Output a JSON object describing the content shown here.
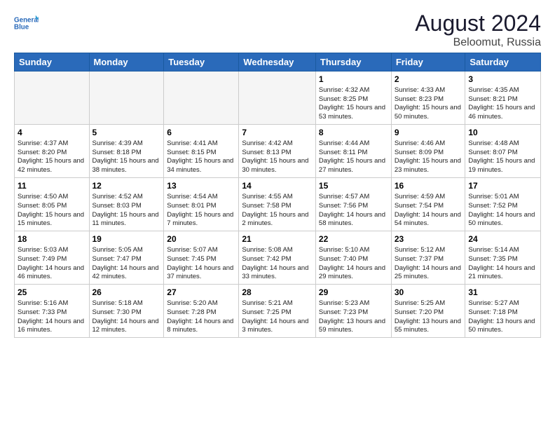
{
  "header": {
    "logo_line1": "General",
    "logo_line2": "Blue",
    "month_year": "August 2024",
    "location": "Beloomut, Russia"
  },
  "weekdays": [
    "Sunday",
    "Monday",
    "Tuesday",
    "Wednesday",
    "Thursday",
    "Friday",
    "Saturday"
  ],
  "weeks": [
    [
      {
        "day": "",
        "info": "",
        "empty": true
      },
      {
        "day": "",
        "info": "",
        "empty": true
      },
      {
        "day": "",
        "info": "",
        "empty": true
      },
      {
        "day": "",
        "info": "",
        "empty": true
      },
      {
        "day": "1",
        "info": "Sunrise: 4:32 AM\nSunset: 8:25 PM\nDaylight: 15 hours\nand 53 minutes.",
        "empty": false
      },
      {
        "day": "2",
        "info": "Sunrise: 4:33 AM\nSunset: 8:23 PM\nDaylight: 15 hours\nand 50 minutes.",
        "empty": false
      },
      {
        "day": "3",
        "info": "Sunrise: 4:35 AM\nSunset: 8:21 PM\nDaylight: 15 hours\nand 46 minutes.",
        "empty": false
      }
    ],
    [
      {
        "day": "4",
        "info": "Sunrise: 4:37 AM\nSunset: 8:20 PM\nDaylight: 15 hours\nand 42 minutes.",
        "empty": false
      },
      {
        "day": "5",
        "info": "Sunrise: 4:39 AM\nSunset: 8:18 PM\nDaylight: 15 hours\nand 38 minutes.",
        "empty": false
      },
      {
        "day": "6",
        "info": "Sunrise: 4:41 AM\nSunset: 8:15 PM\nDaylight: 15 hours\nand 34 minutes.",
        "empty": false
      },
      {
        "day": "7",
        "info": "Sunrise: 4:42 AM\nSunset: 8:13 PM\nDaylight: 15 hours\nand 30 minutes.",
        "empty": false
      },
      {
        "day": "8",
        "info": "Sunrise: 4:44 AM\nSunset: 8:11 PM\nDaylight: 15 hours\nand 27 minutes.",
        "empty": false
      },
      {
        "day": "9",
        "info": "Sunrise: 4:46 AM\nSunset: 8:09 PM\nDaylight: 15 hours\nand 23 minutes.",
        "empty": false
      },
      {
        "day": "10",
        "info": "Sunrise: 4:48 AM\nSunset: 8:07 PM\nDaylight: 15 hours\nand 19 minutes.",
        "empty": false
      }
    ],
    [
      {
        "day": "11",
        "info": "Sunrise: 4:50 AM\nSunset: 8:05 PM\nDaylight: 15 hours\nand 15 minutes.",
        "empty": false
      },
      {
        "day": "12",
        "info": "Sunrise: 4:52 AM\nSunset: 8:03 PM\nDaylight: 15 hours\nand 11 minutes.",
        "empty": false
      },
      {
        "day": "13",
        "info": "Sunrise: 4:54 AM\nSunset: 8:01 PM\nDaylight: 15 hours\nand 7 minutes.",
        "empty": false
      },
      {
        "day": "14",
        "info": "Sunrise: 4:55 AM\nSunset: 7:58 PM\nDaylight: 15 hours\nand 2 minutes.",
        "empty": false
      },
      {
        "day": "15",
        "info": "Sunrise: 4:57 AM\nSunset: 7:56 PM\nDaylight: 14 hours\nand 58 minutes.",
        "empty": false
      },
      {
        "day": "16",
        "info": "Sunrise: 4:59 AM\nSunset: 7:54 PM\nDaylight: 14 hours\nand 54 minutes.",
        "empty": false
      },
      {
        "day": "17",
        "info": "Sunrise: 5:01 AM\nSunset: 7:52 PM\nDaylight: 14 hours\nand 50 minutes.",
        "empty": false
      }
    ],
    [
      {
        "day": "18",
        "info": "Sunrise: 5:03 AM\nSunset: 7:49 PM\nDaylight: 14 hours\nand 46 minutes.",
        "empty": false
      },
      {
        "day": "19",
        "info": "Sunrise: 5:05 AM\nSunset: 7:47 PM\nDaylight: 14 hours\nand 42 minutes.",
        "empty": false
      },
      {
        "day": "20",
        "info": "Sunrise: 5:07 AM\nSunset: 7:45 PM\nDaylight: 14 hours\nand 37 minutes.",
        "empty": false
      },
      {
        "day": "21",
        "info": "Sunrise: 5:08 AM\nSunset: 7:42 PM\nDaylight: 14 hours\nand 33 minutes.",
        "empty": false
      },
      {
        "day": "22",
        "info": "Sunrise: 5:10 AM\nSunset: 7:40 PM\nDaylight: 14 hours\nand 29 minutes.",
        "empty": false
      },
      {
        "day": "23",
        "info": "Sunrise: 5:12 AM\nSunset: 7:37 PM\nDaylight: 14 hours\nand 25 minutes.",
        "empty": false
      },
      {
        "day": "24",
        "info": "Sunrise: 5:14 AM\nSunset: 7:35 PM\nDaylight: 14 hours\nand 21 minutes.",
        "empty": false
      }
    ],
    [
      {
        "day": "25",
        "info": "Sunrise: 5:16 AM\nSunset: 7:33 PM\nDaylight: 14 hours\nand 16 minutes.",
        "empty": false
      },
      {
        "day": "26",
        "info": "Sunrise: 5:18 AM\nSunset: 7:30 PM\nDaylight: 14 hours\nand 12 minutes.",
        "empty": false
      },
      {
        "day": "27",
        "info": "Sunrise: 5:20 AM\nSunset: 7:28 PM\nDaylight: 14 hours\nand 8 minutes.",
        "empty": false
      },
      {
        "day": "28",
        "info": "Sunrise: 5:21 AM\nSunset: 7:25 PM\nDaylight: 14 hours\nand 3 minutes.",
        "empty": false
      },
      {
        "day": "29",
        "info": "Sunrise: 5:23 AM\nSunset: 7:23 PM\nDaylight: 13 hours\nand 59 minutes.",
        "empty": false
      },
      {
        "day": "30",
        "info": "Sunrise: 5:25 AM\nSunset: 7:20 PM\nDaylight: 13 hours\nand 55 minutes.",
        "empty": false
      },
      {
        "day": "31",
        "info": "Sunrise: 5:27 AM\nSunset: 7:18 PM\nDaylight: 13 hours\nand 50 minutes.",
        "empty": false
      }
    ]
  ]
}
